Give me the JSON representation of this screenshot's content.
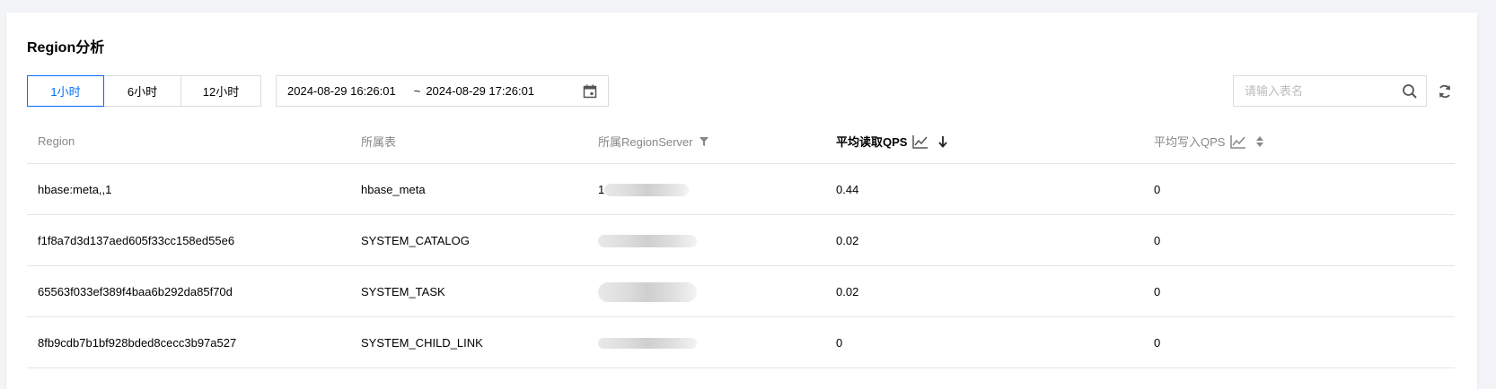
{
  "title": "Region分析",
  "time_range": {
    "options": [
      "1小时",
      "6小时",
      "12小时"
    ],
    "active": "1小时"
  },
  "date_range": {
    "start": "2024-08-29 16:26:01",
    "separator": "~",
    "end": "2024-08-29 17:26:01"
  },
  "search": {
    "placeholder": "请输入表名",
    "value": ""
  },
  "table": {
    "columns": [
      "Region",
      "所属表",
      "所属RegionServer",
      "平均读取QPS",
      "平均写入QPS"
    ],
    "rows": [
      {
        "region": "hbase:meta,,1",
        "table": "hbase_meta",
        "server": "1",
        "read_qps": "0.44",
        "write_qps": "0"
      },
      {
        "region": "f1f8a7d3d137aed605f33cc158ed55e6",
        "table": "SYSTEM_CATALOG",
        "server": "",
        "read_qps": "0.02",
        "write_qps": "0"
      },
      {
        "region": "65563f033ef389f4baa6b292da85f70d",
        "table": "SYSTEM_TASK",
        "server": "",
        "read_qps": "0.02",
        "write_qps": "0"
      },
      {
        "region": "8fb9cdb7b1bf928bded8cecc3b97a527",
        "table": "SYSTEM_CHILD_LINK",
        "server": "",
        "read_qps": "0",
        "write_qps": "0"
      }
    ]
  },
  "icons": {
    "calendar": "calendar-icon",
    "search": "search-icon",
    "refresh": "refresh-icon",
    "filter": "filter-icon",
    "chart": "line-chart-icon",
    "sort_desc": "sort-desc-icon",
    "sort_both": "sort-icon"
  },
  "colors": {
    "accent": "#006eff",
    "border": "#dcdcdc",
    "header_text": "#888888"
  }
}
